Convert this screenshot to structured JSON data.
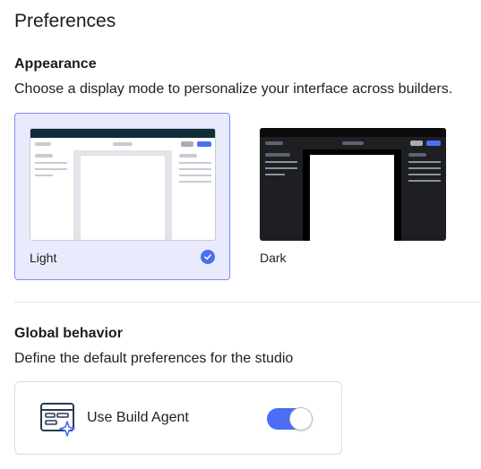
{
  "page": {
    "title": "Preferences"
  },
  "appearance": {
    "title": "Appearance",
    "description": "Choose a display mode to personalize your interface across builders.",
    "modes": [
      {
        "label": "Light",
        "selected": true
      },
      {
        "label": "Dark",
        "selected": false
      }
    ]
  },
  "global_behavior": {
    "title": "Global behavior",
    "description": "Define the default preferences for the studio",
    "build_agent": {
      "label": "Use Build Agent",
      "enabled": true,
      "icon": "build-agent-icon"
    }
  },
  "colors": {
    "accent": "#4b6ef5",
    "selected_bg": "#e9ebfd",
    "selected_border": "#7d8cf0"
  }
}
